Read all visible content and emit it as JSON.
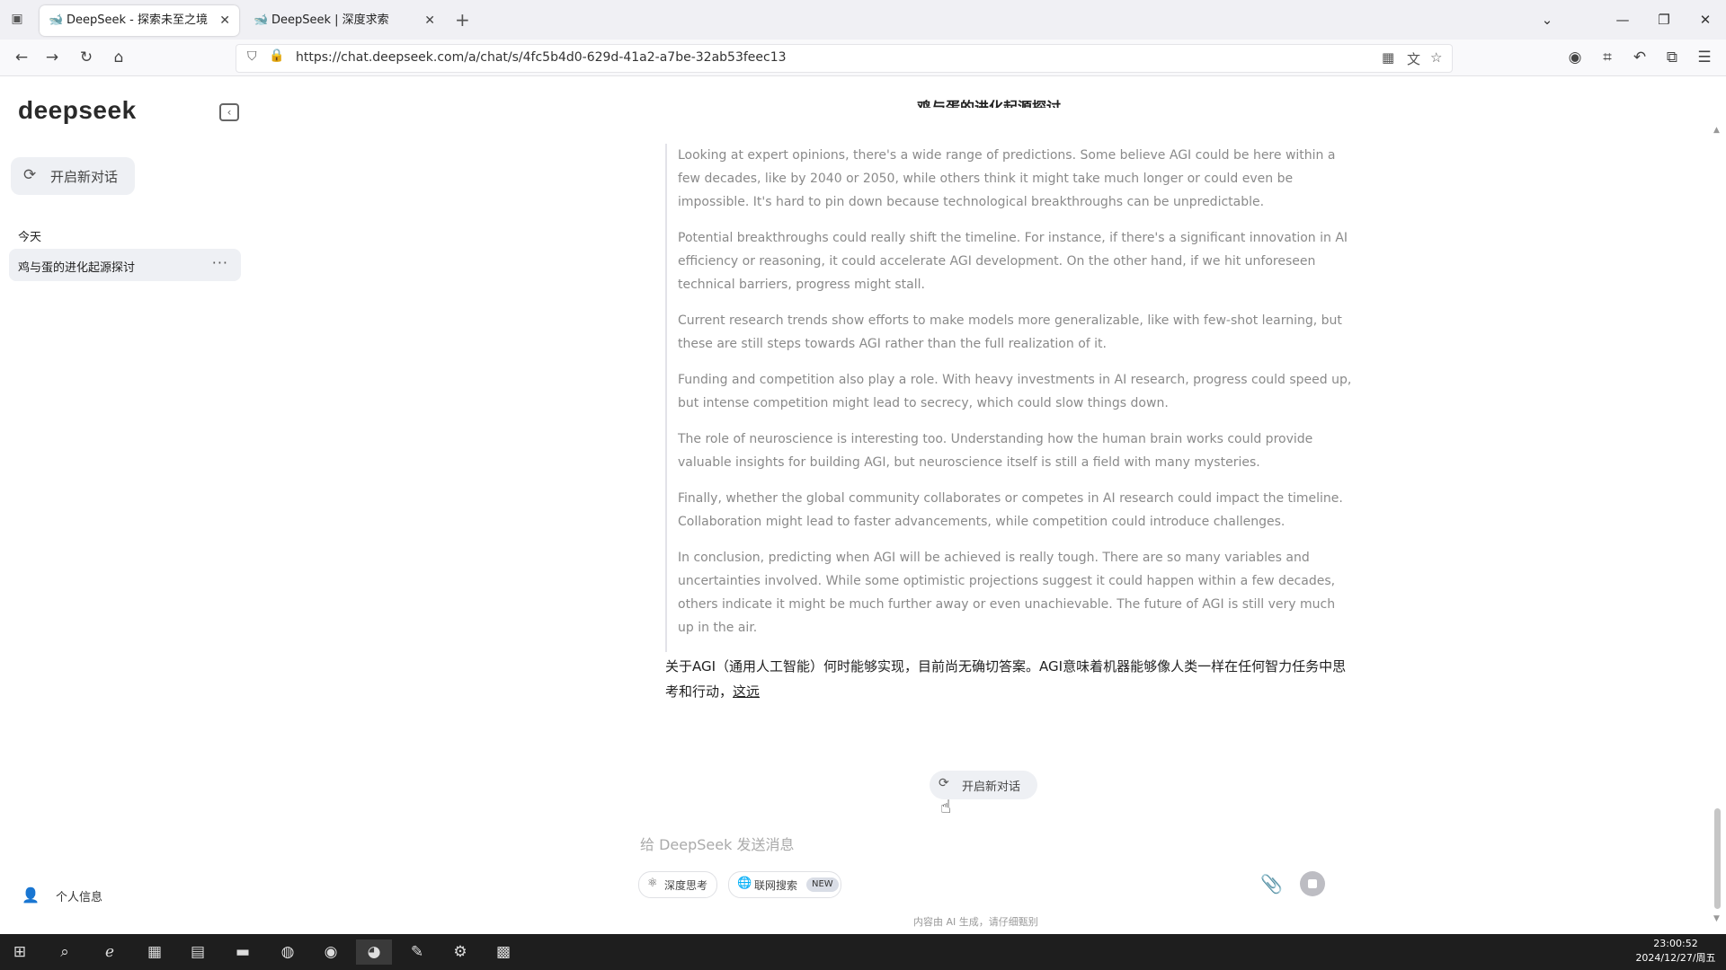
{
  "browser": {
    "tabs": [
      {
        "title": "DeepSeek - 探索未至之境",
        "active": true
      },
      {
        "title": "DeepSeek | 深度求索",
        "active": false
      }
    ],
    "url": "https://chat.deepseek.com/a/chat/s/4fc5b4d0-629d-41a2-a7be-32ab53feec13"
  },
  "sidebar": {
    "logo": "deepseek",
    "new_chat_label": "开启新对话",
    "section_today": "今天",
    "conversations": [
      {
        "title": "鸡与蛋的进化起源探讨"
      }
    ],
    "more_label": "···",
    "profile_label": "个人信息"
  },
  "chat": {
    "title": "鸡与蛋的进化起源探讨",
    "thinking_paragraphs": [
      "Looking at expert opinions, there's a wide range of predictions. Some believe AGI could be here within a few decades, like by 2040 or 2050, while others think it might take much longer or could even be impossible. It's hard to pin down because technological breakthroughs can be unpredictable.",
      "Potential breakthroughs could really shift the timeline. For instance, if there's a significant innovation in AI efficiency or reasoning, it could accelerate AGI development. On the other hand, if we hit unforeseen technical barriers, progress might stall.",
      "Current research trends show efforts to make models more generalizable, like with few-shot learning, but these are still steps towards AGI rather than the full realization of it.",
      "Funding and competition also play a role. With heavy investments in AI research, progress could speed up, but intense competition might lead to secrecy, which could slow things down.",
      "The role of neuroscience is interesting too. Understanding how the human brain works could provide valuable insights for building AGI, but neuroscience itself is still a field with many mysteries.",
      "Finally, whether the global community collaborates or competes in AI research could impact the timeline. Collaboration might lead to faster advancements, while competition could introduce challenges.",
      "In conclusion, predicting when AGI will be achieved is really tough. There are so many variables and uncertainties involved. While some optimistic projections suggest it could happen within a few decades, others indicate it might be much further away or even unachievable. The future of AGI is still very much up in the air."
    ],
    "answer_text": "关于AGI（通用人工智能）何时能够实现，目前尚无确切答案。AGI意味着机器能够像人类一样在任何智力任务中思考和行动，",
    "answer_tail": "这远",
    "floating_new_chat": "开启新对话"
  },
  "composer": {
    "placeholder": "给 DeepSeek 发送消息",
    "deep_think_label": "深度思考",
    "web_search_label": "联网搜索",
    "web_search_badge": "NEW"
  },
  "disclaimer": "内容由 AI 生成，请仔细甄别",
  "taskbar": {
    "time": "23:00:52",
    "date": "2024/12/27/周五"
  }
}
